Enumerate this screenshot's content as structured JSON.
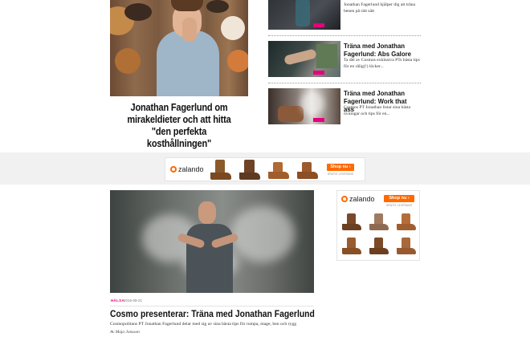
{
  "hero": {
    "title": "Jonathan Fagerlund om mirakeldieter och att hitta \"den perfekta kosthållningen\""
  },
  "side_items": [
    {
      "title": "",
      "desc": "Jonathan Fagerlund hjälper dig att träna benen på rätt sätt"
    },
    {
      "title": "Träna med Jonathan Fagerlund: Abs Galore",
      "desc": "Ta del av Cosmos exklusiva PTs bästa tips för en rälig(!) löcker..."
    },
    {
      "title": "Träna med Jonathan Fagerlund: Work that ass",
      "desc": "Cosmos PT Jonathan listar sina bästa övningar och tips för en..."
    }
  ],
  "ads": {
    "brand": "zalando",
    "cta": "Shop nu",
    "cta_arrow": "›",
    "shipping": "GRATIS LEVERANS",
    "accent": "#ff6900"
  },
  "article": {
    "tag": "HÄLSA",
    "date": "2016-09-21",
    "title": "Cosmo presenterar: Träna med Jonathan Fagerlund",
    "desc": "Cosmopolitans PT Jonathan Fagerlund delar med sig av sina bästa tips för rumpa, mage, ben och rygg",
    "author": "Av Maja Jonsson",
    "tag_color": "#e6007e"
  }
}
